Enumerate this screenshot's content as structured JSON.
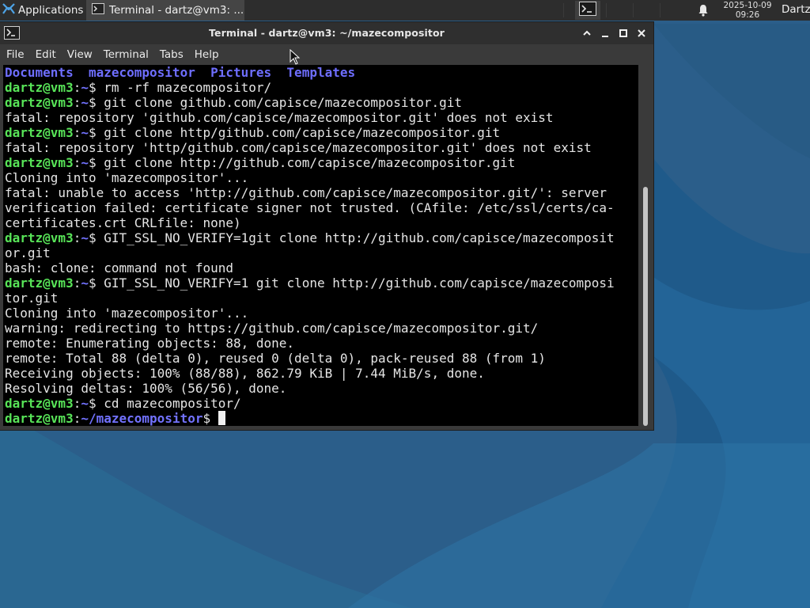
{
  "panel": {
    "applications_label": "Applications",
    "task_title": "Terminal - dartz@vm3: ...",
    "clock_date": "2025-10-09",
    "clock_time": "09:26",
    "user_label": "Dartz"
  },
  "window": {
    "title": "Terminal - dartz@vm3: ~/mazecompositor",
    "controls": {
      "maximize_up": "^",
      "minimize": "–",
      "maximize": "□",
      "close": "✕"
    }
  },
  "menu": [
    "File",
    "Edit",
    "View",
    "Terminal",
    "Tabs",
    "Help"
  ],
  "terminal": {
    "prompt_user": "dartz@vm3",
    "lines": [
      {
        "t": "ls",
        "items": [
          "Documents",
          "mazecompositor",
          "Pictures",
          "Templates"
        ]
      },
      {
        "t": "cmd",
        "path": "~",
        "text": "rm -rf mazecompositor/"
      },
      {
        "t": "cmd",
        "path": "~",
        "text": "git clone github.com/capisce/mazecompositor.git"
      },
      {
        "t": "out",
        "text": "fatal: repository 'github.com/capisce/mazecompositor.git' does not exist"
      },
      {
        "t": "cmd",
        "path": "~",
        "text": "git clone http/github.com/capisce/mazecompositor.git"
      },
      {
        "t": "out",
        "text": "fatal: repository 'http/github.com/capisce/mazecompositor.git' does not exist"
      },
      {
        "t": "cmd",
        "path": "~",
        "text": "git clone http://github.com/capisce/mazecompositor.git"
      },
      {
        "t": "out",
        "text": "Cloning into 'mazecompositor'..."
      },
      {
        "t": "out",
        "text": "fatal: unable to access 'http://github.com/capisce/mazecompositor.git/': server"
      },
      {
        "t": "out",
        "text": "verification failed: certificate signer not trusted. (CAfile: /etc/ssl/certs/ca-"
      },
      {
        "t": "out",
        "text": "certificates.crt CRLfile: none)"
      },
      {
        "t": "cmd",
        "path": "~",
        "text": "GIT_SSL_NO_VERIFY=1git clone http://github.com/capisce/mazecomposit"
      },
      {
        "t": "out",
        "text": "or.git"
      },
      {
        "t": "out",
        "text": "bash: clone: command not found"
      },
      {
        "t": "cmd",
        "path": "~",
        "text": "GIT_SSL_NO_VERIFY=1 git clone http://github.com/capisce/mazecomposi"
      },
      {
        "t": "out",
        "text": "tor.git"
      },
      {
        "t": "out",
        "text": "Cloning into 'mazecompositor'..."
      },
      {
        "t": "out",
        "text": "warning: redirecting to https://github.com/capisce/mazecompositor.git/"
      },
      {
        "t": "out",
        "text": "remote: Enumerating objects: 88, done."
      },
      {
        "t": "out",
        "text": "remote: Total 88 (delta 0), reused 0 (delta 0), pack-reused 88 (from 1)"
      },
      {
        "t": "out",
        "text": "Receiving objects: 100% (88/88), 862.79 KiB | 7.44 MiB/s, done."
      },
      {
        "t": "out",
        "text": "Resolving deltas: 100% (56/56), done."
      },
      {
        "t": "cmd",
        "path": "~",
        "text": "cd mazecompositor/"
      },
      {
        "t": "cmd",
        "path": "~/mazecompositor",
        "text": "",
        "cursor": true
      }
    ]
  },
  "colors": {
    "prompt_user": "#58e458",
    "prompt_path": "#7272ff",
    "terminal_bg": "#000000",
    "terminal_fg": "#e5e5e5",
    "panel_bg": "#2d2d2d",
    "titlebar_bg": "#2f2f2f"
  },
  "icons": {
    "applications": "xfce-logo-icon",
    "task": "terminal-icon",
    "notifications": "bell-icon",
    "mouse": "mouse-pointer-icon"
  }
}
